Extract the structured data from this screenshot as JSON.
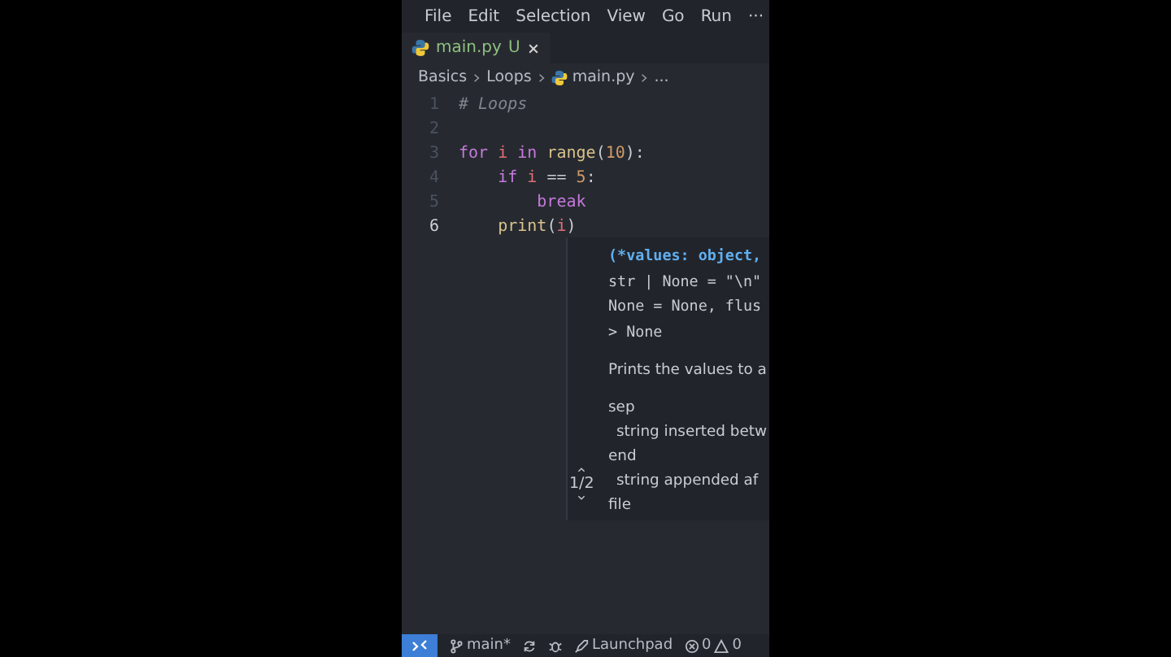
{
  "menu": [
    "File",
    "Edit",
    "Selection",
    "View",
    "Go",
    "Run",
    "···"
  ],
  "tabs": [
    {
      "label": "main.py",
      "badge": "U",
      "selected": true
    }
  ],
  "breadcrumb": [
    "Basics",
    "Loops",
    "main.py",
    "..."
  ],
  "lines": [
    {
      "number": "1",
      "current": false,
      "tokens": [
        {
          "kind": "comment",
          "text": "# Loops"
        }
      ]
    },
    {
      "number": "2",
      "current": false
    },
    {
      "number": "3",
      "current": false,
      "tokens": [
        {
          "kind": "keyword",
          "text": "for "
        },
        {
          "kind": "var",
          "text": "i"
        },
        {
          "kind": "keyword",
          "text": " in "
        },
        {
          "kind": "func",
          "text": "range"
        },
        {
          "kind": "plain",
          "text": "("
        },
        {
          "kind": "number",
          "text": "10"
        },
        {
          "kind": "plain",
          "text": "):"
        }
      ]
    },
    {
      "number": "4",
      "current": false,
      "tokens": [
        {
          "kind": "keyword",
          "text": "    if "
        },
        {
          "kind": "var",
          "text": "i"
        },
        {
          "kind": "plain",
          "text": " == "
        },
        {
          "kind": "number",
          "text": "5"
        },
        {
          "kind": "plain",
          "text": ":"
        }
      ]
    },
    {
      "number": "5",
      "current": false,
      "tokens": [
        {
          "kind": "keyword",
          "text": "        break"
        }
      ]
    },
    {
      "number": "6",
      "current": true,
      "tokens": [
        {
          "kind": "func",
          "text": "    print"
        },
        {
          "kind": "plain",
          "text": "("
        },
        {
          "kind": "var",
          "text": "i"
        },
        {
          "kind": "plain",
          "text": ")"
        }
      ]
    }
  ],
  "hover": {
    "signature": [
      {
        "kind": "param",
        "text": "(*values: object,"
      },
      {
        "kind": "code",
        "text": "str | None = \"\\n\""
      },
      {
        "kind": "code",
        "text": "None = None, flus"
      },
      {
        "kind": "code",
        "text": "> None"
      }
    ],
    "description": "Prints the values to a",
    "params": [
      {
        "name": "sep",
        "doc": "string inserted betw"
      },
      {
        "name": "end",
        "doc": "string appended af"
      },
      {
        "name": "file"
      }
    ],
    "counter": "1/2"
  },
  "status": {
    "branch": "main*",
    "launchpad": "Launchpad",
    "errors": "0",
    "warnings": "0"
  }
}
